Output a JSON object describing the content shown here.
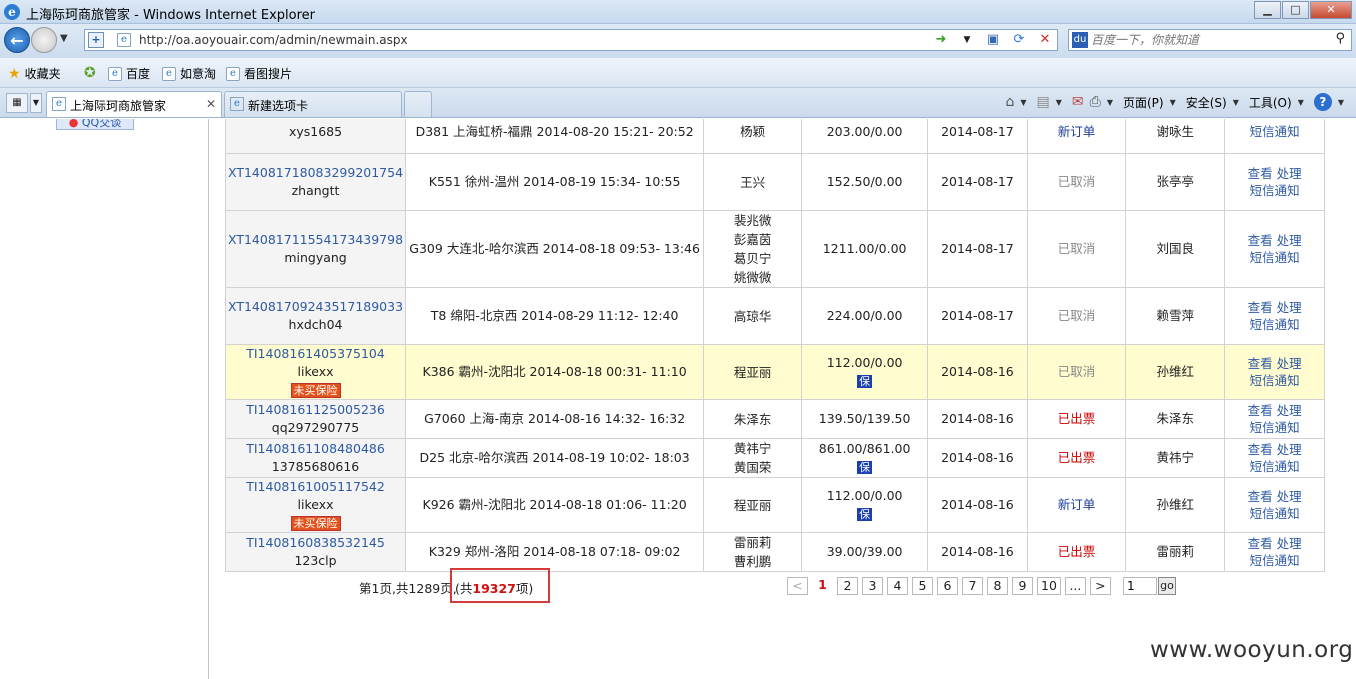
{
  "window": {
    "title": "上海际珂商旅管家 - Windows Internet Explorer",
    "min": "▁",
    "max": "□",
    "close": "✕"
  },
  "address": {
    "url": "http://oa.aoyouair.com/admin/newmain.aspx",
    "search_placeholder": "百度一下，你就知道"
  },
  "favorites": {
    "label": "收藏夹",
    "links": [
      "百度",
      "如意淘",
      "看图搜片"
    ]
  },
  "tabs": [
    {
      "label": "上海际珂商旅管家",
      "active": true
    },
    {
      "label": "新建选项卡",
      "active": false
    }
  ],
  "commandbar": {
    "page": "页面(P)",
    "safety": "安全(S)",
    "tools": "工具(O)",
    "help": "?"
  },
  "sidebar": {
    "qq_link": "QQ交谈"
  },
  "orders": [
    {
      "order_id": "",
      "user": "xys1685",
      "no_insurance": "",
      "trip": "D381 上海虹桥-福鼎 2014-08-20 15:21- 20:52",
      "passengers": [
        "杨颖"
      ],
      "price": "203.00/0.00",
      "insured": false,
      "date": "2014-08-17",
      "status": "新订单",
      "status_type": "new",
      "contact": "谢咏生",
      "actions": {
        "view": "",
        "process": "",
        "sms": "短信通知"
      },
      "highlight": false
    },
    {
      "order_id": "XT14081718083299201754",
      "user": "zhangtt",
      "no_insurance": "",
      "trip": "K551 徐州-温州 2014-08-19 15:34- 10:55",
      "passengers": [
        "王兴"
      ],
      "price": "152.50/0.00",
      "insured": false,
      "date": "2014-08-17",
      "status": "已取消",
      "status_type": "cancel",
      "contact": "张亭亭",
      "actions": {
        "view": "查看",
        "process": "处理",
        "sms": "短信通知"
      },
      "highlight": false
    },
    {
      "order_id": "XT14081711554173439798",
      "user": "mingyang",
      "no_insurance": "",
      "trip": "G309 大连北-哈尔滨西 2014-08-18 09:53- 13:46",
      "passengers": [
        "裴兆微",
        "彭嘉茵",
        "葛贝宁",
        "姚微微"
      ],
      "price": "1211.00/0.00",
      "insured": false,
      "date": "2014-08-17",
      "status": "已取消",
      "status_type": "cancel",
      "contact": "刘国良",
      "actions": {
        "view": "查看",
        "process": "处理",
        "sms": "短信通知"
      },
      "highlight": false
    },
    {
      "order_id": "XT14081709243517189033",
      "user": "hxdch04",
      "no_insurance": "",
      "trip": "T8 绵阳-北京西 2014-08-29 11:12- 12:40",
      "passengers": [
        "高琼华"
      ],
      "price": "224.00/0.00",
      "insured": false,
      "date": "2014-08-17",
      "status": "已取消",
      "status_type": "cancel",
      "contact": "赖雪萍",
      "actions": {
        "view": "查看",
        "process": "处理",
        "sms": "短信通知"
      },
      "highlight": false
    },
    {
      "order_id": "TI1408161405375104",
      "user": "likexx",
      "no_insurance": "未买保险",
      "trip": "K386 霸州-沈阳北 2014-08-18 00:31- 11:10",
      "passengers": [
        "程亚丽"
      ],
      "price": "112.00/0.00",
      "insured": true,
      "date": "2014-08-16",
      "status": "已取消",
      "status_type": "cancel",
      "contact": "孙维红",
      "actions": {
        "view": "查看",
        "process": "处理",
        "sms": "短信通知"
      },
      "highlight": true
    },
    {
      "order_id": "TI1408161125005236",
      "user": "qq297290775",
      "no_insurance": "",
      "trip": "G7060 上海-南京 2014-08-16 14:32- 16:32",
      "passengers": [
        "朱泽东"
      ],
      "price": "139.50/139.50",
      "insured": false,
      "date": "2014-08-16",
      "status": "已出票",
      "status_type": "issued",
      "contact": "朱泽东",
      "actions": {
        "view": "查看",
        "process": "处理",
        "sms": "短信通知"
      },
      "highlight": false
    },
    {
      "order_id": "TI1408161108480486",
      "user": "13785680616",
      "no_insurance": "",
      "trip": "D25 北京-哈尔滨西 2014-08-19 10:02- 18:03",
      "passengers": [
        "黄祎宁",
        "黄国荣"
      ],
      "price": "861.00/861.00",
      "insured": true,
      "date": "2014-08-16",
      "status": "已出票",
      "status_type": "issued",
      "contact": "黄祎宁",
      "actions": {
        "view": "查看",
        "process": "处理",
        "sms": "短信通知"
      },
      "highlight": false
    },
    {
      "order_id": "TI1408161005117542",
      "user": "likexx",
      "no_insurance": "未买保险",
      "trip": "K926 霸州-沈阳北 2014-08-18 01:06- 11:20",
      "passengers": [
        "程亚丽"
      ],
      "price": "112.00/0.00",
      "insured": true,
      "date": "2014-08-16",
      "status": "新订单",
      "status_type": "new",
      "contact": "孙维红",
      "actions": {
        "view": "查看",
        "process": "处理",
        "sms": "短信通知"
      },
      "highlight": false
    },
    {
      "order_id": "TI1408160838532145",
      "user": "123clp",
      "no_insurance": "",
      "trip": "K329 郑州-洛阳 2014-08-18 07:18- 09:02",
      "passengers": [
        "雷丽莉",
        "曹利鹏"
      ],
      "price": "39.00/39.00",
      "insured": false,
      "date": "2014-08-16",
      "status": "已出票",
      "status_type": "issued",
      "contact": "雷丽莉",
      "actions": {
        "view": "查看",
        "process": "处理",
        "sms": "短信通知"
      },
      "highlight": false
    }
  ],
  "insured_label": "保",
  "pagination": {
    "page_info": "第1页,共1289页,",
    "total_prefix": "(共",
    "total_count": "19327",
    "total_suffix": "项)",
    "prev": "<",
    "next": ">",
    "pages": [
      "1",
      "2",
      "3",
      "4",
      "5",
      "6",
      "7",
      "8",
      "9",
      "10",
      "..."
    ],
    "current": "1",
    "goto_value": "1",
    "go_label": "go"
  },
  "watermark": "www.wooyun.org"
}
